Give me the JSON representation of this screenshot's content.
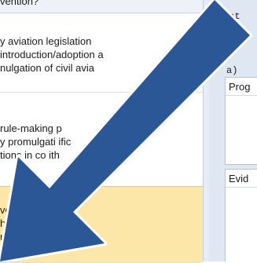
{
  "questions": {
    "top_fragment": "vention?",
    "items": [
      {
        "lines": [
          "y aviation legislation",
          "introduction/adoption a",
          "nulgation of civil avia"
        ]
      },
      {
        "lines": [
          "rule-making p",
          "y promulgati         ific",
          "tions in co         ith"
        ]
      },
      {
        "lines": [
          "ve            plemented",
          "he            t of its",
          "ns          "
        ]
      }
    ]
  },
  "detail_pane": {
    "code_line_1": "cat",
    "code_line_2": "SAR",
    "small_mark": "a)",
    "fields": [
      {
        "label": "Prog"
      },
      {
        "label": "Evid"
      }
    ]
  },
  "overlay_arrow": {
    "icon": "down-left-arrow-icon",
    "color": "#2b5797",
    "outline_color": "#ffffff"
  }
}
